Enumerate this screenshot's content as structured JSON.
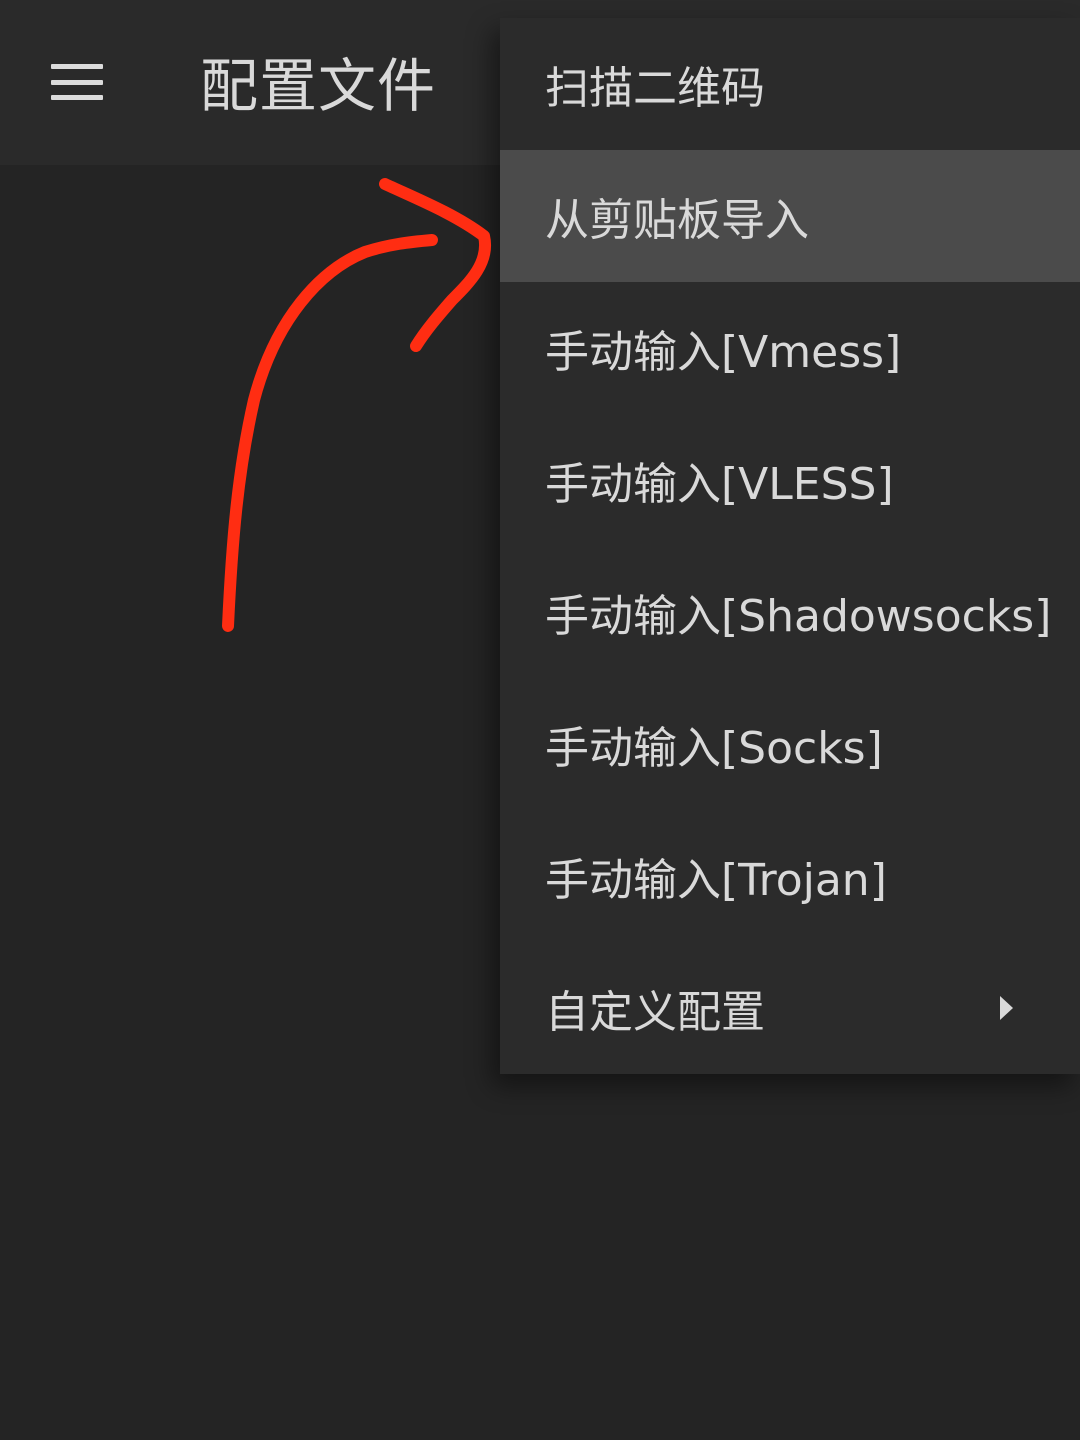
{
  "app_bar": {
    "title": "配置文件",
    "nav_icon": "menu-icon"
  },
  "menu": {
    "items": [
      {
        "label": "扫描二维码",
        "highlighted": false
      },
      {
        "label": "从剪贴板导入",
        "highlighted": true
      },
      {
        "label": "手动输入[Vmess]",
        "highlighted": false
      },
      {
        "label": "手动输入[VLESS]",
        "highlighted": false
      },
      {
        "label": "手动输入[Shadowsocks]",
        "highlighted": false
      },
      {
        "label": "手动输入[Socks]",
        "highlighted": false
      },
      {
        "label": "手动输入[Trojan]",
        "highlighted": false
      },
      {
        "label": "自定义配置",
        "highlighted": false,
        "has_submenu": true,
        "submenu_icon": "chevron-right-icon"
      }
    ]
  },
  "annotation": {
    "type": "hand-drawn arrow",
    "color": "#ff2d12"
  },
  "colors": {
    "background": "#242424",
    "app_bar": "#2a2a2a",
    "menu_background": "#2b2b2b",
    "menu_highlight": "#4b4b4b",
    "text": "#d9d9d9",
    "annotation": "#ff2d12"
  }
}
